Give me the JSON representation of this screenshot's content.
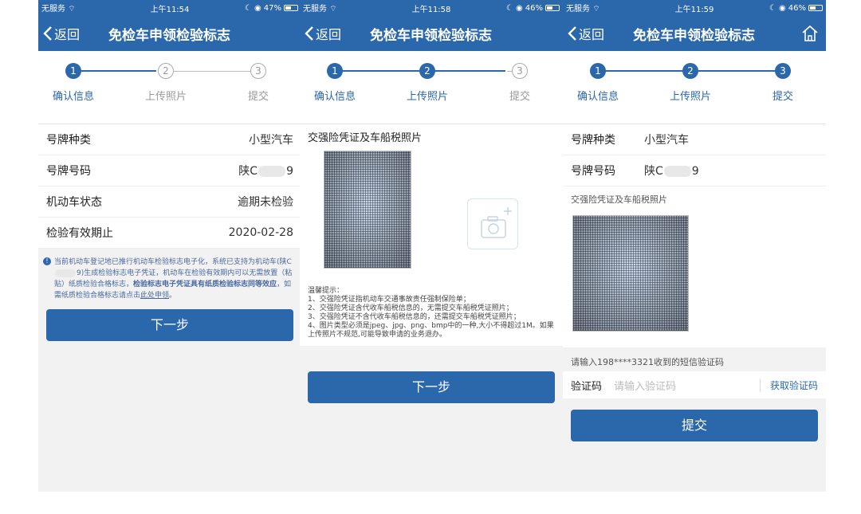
{
  "status": {
    "carrier": "无服务",
    "p1_time": "上午11:54",
    "p1_battery": "47%",
    "p2_time": "上午11:58",
    "p2_battery": "46%",
    "p3_time": "上午11:59",
    "p3_battery": "46%"
  },
  "nav": {
    "back": "返回",
    "title": "免检车申领检验标志"
  },
  "steps": [
    {
      "num": "1",
      "label": "确认信息"
    },
    {
      "num": "2",
      "label": "上传照片"
    },
    {
      "num": "3",
      "label": "提交"
    }
  ],
  "screen1": {
    "rows": [
      {
        "key": "号牌种类",
        "value": "小型汽车"
      },
      {
        "key": "号牌号码",
        "value_prefix": "陕C",
        "value_suffix": "9"
      },
      {
        "key": "机动车状态",
        "value": "逾期未检验"
      },
      {
        "key": "检验有效期止",
        "value": "2020-02-28"
      }
    ],
    "notice_a": "当前机动车登记地已推行机动车检验标志电子化，系统已支持为机动车(陕C",
    "notice_b": "9)生成检验标志电子凭证，机动车在检验有效期内可以无需放置（粘贴）纸质检验合格标志，",
    "notice_bold": "检验标志电子凭证具有纸质检验标志同等效应",
    "notice_c": "，如需纸质检验合格标志请点击",
    "notice_link": "此处申领",
    "notice_end": "。",
    "next": "下一步"
  },
  "screen2": {
    "section": "交强险凭证及车船税照片",
    "tips_title": "温馨提示：",
    "tips": [
      "1、交强险凭证指机动车交通事故责任强制保险单；",
      "2、交强险凭证含代收车船税信息的，无需提交车船税凭证照片；",
      "3、交强险凭证不含代收车船税信息的，还需提交车船税凭证照片；",
      "4、图片类型必须是jpeg、jpg、png、bmp中的一种,大小不得超过1M。如果上传照片不规范,可能导致申请的业务退办。"
    ],
    "next": "下一步"
  },
  "screen3": {
    "rows": [
      {
        "key": "号牌种类",
        "value": "小型汽车"
      },
      {
        "key": "号牌号码",
        "value_prefix": "陕C",
        "value_suffix": "9"
      }
    ],
    "photo_label": "交强险凭证及车船税照片",
    "sms_hint": "请输入198****3321收到的短信验证码",
    "code_label": "验证码",
    "code_placeholder": "请输入验证码",
    "get_code": "获取验证码",
    "submit": "提交"
  },
  "colors": {
    "brand": "#2b67ab"
  }
}
